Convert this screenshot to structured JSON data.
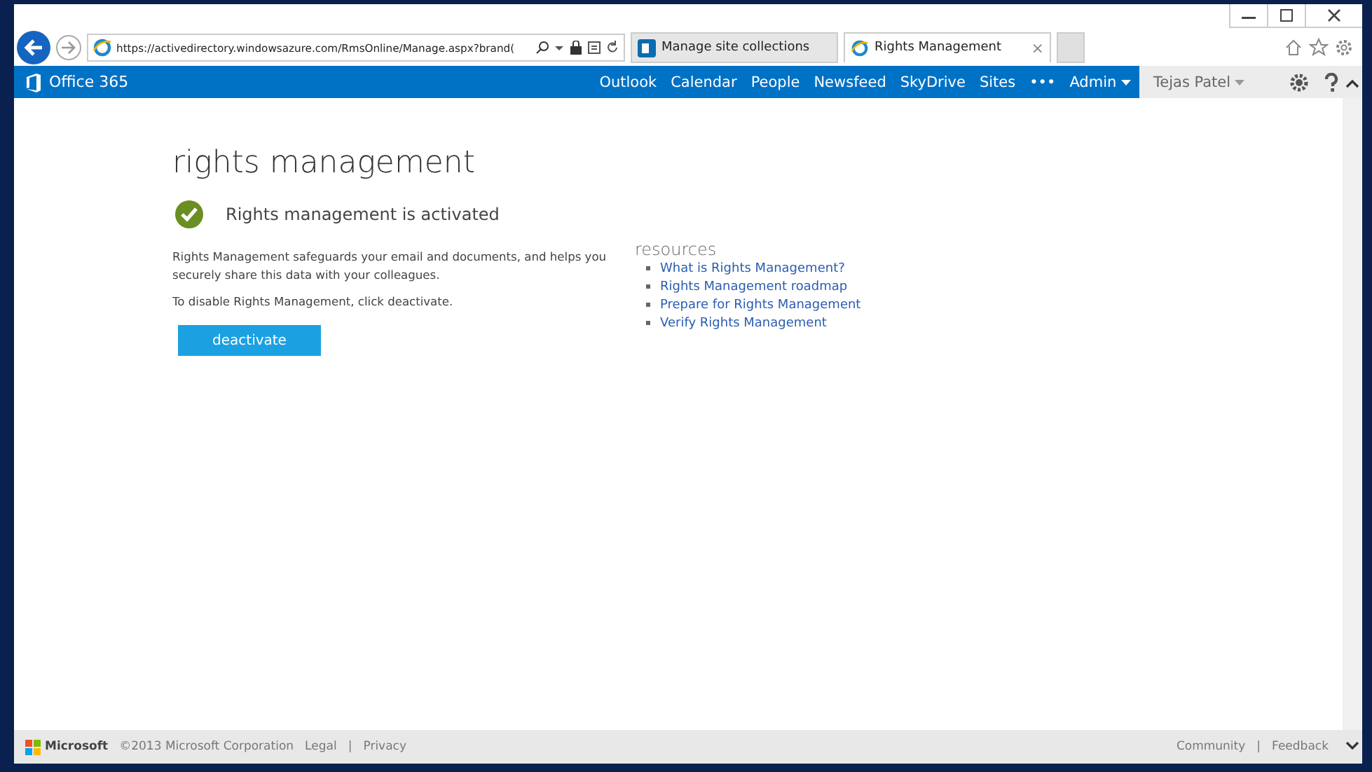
{
  "browser": {
    "url": "https://activedirectory.windowsazure.com/RmsOnline/Manage.aspx?brand(",
    "tabs": [
      {
        "label": "Manage site collections",
        "selected": false
      },
      {
        "label": "Rights Management",
        "selected": true,
        "close": "×"
      }
    ]
  },
  "suite_bar": {
    "brand": "Office 365",
    "nav": [
      "Outlook",
      "Calendar",
      "People",
      "Newsfeed",
      "SkyDrive",
      "Sites",
      "•••"
    ],
    "admin": "Admin",
    "user": "Tejas Patel"
  },
  "page": {
    "title": "rights management",
    "status": "Rights management is activated",
    "description": "Rights Management safeguards your email and documents, and helps you securely share this data with your colleagues.",
    "instruction": "To disable Rights Management, click deactivate.",
    "button": "deactivate",
    "resources": {
      "heading": "resources",
      "links": [
        "What is Rights Management?",
        "Rights Management roadmap",
        "Prepare for Rights Management",
        "Verify Rights Management"
      ]
    }
  },
  "footer": {
    "brand": "Microsoft",
    "copyright": "©2013 Microsoft Corporation",
    "left_links": [
      "Legal",
      "Privacy"
    ],
    "right_links": [
      "Community",
      "Feedback"
    ],
    "separator": "|"
  }
}
